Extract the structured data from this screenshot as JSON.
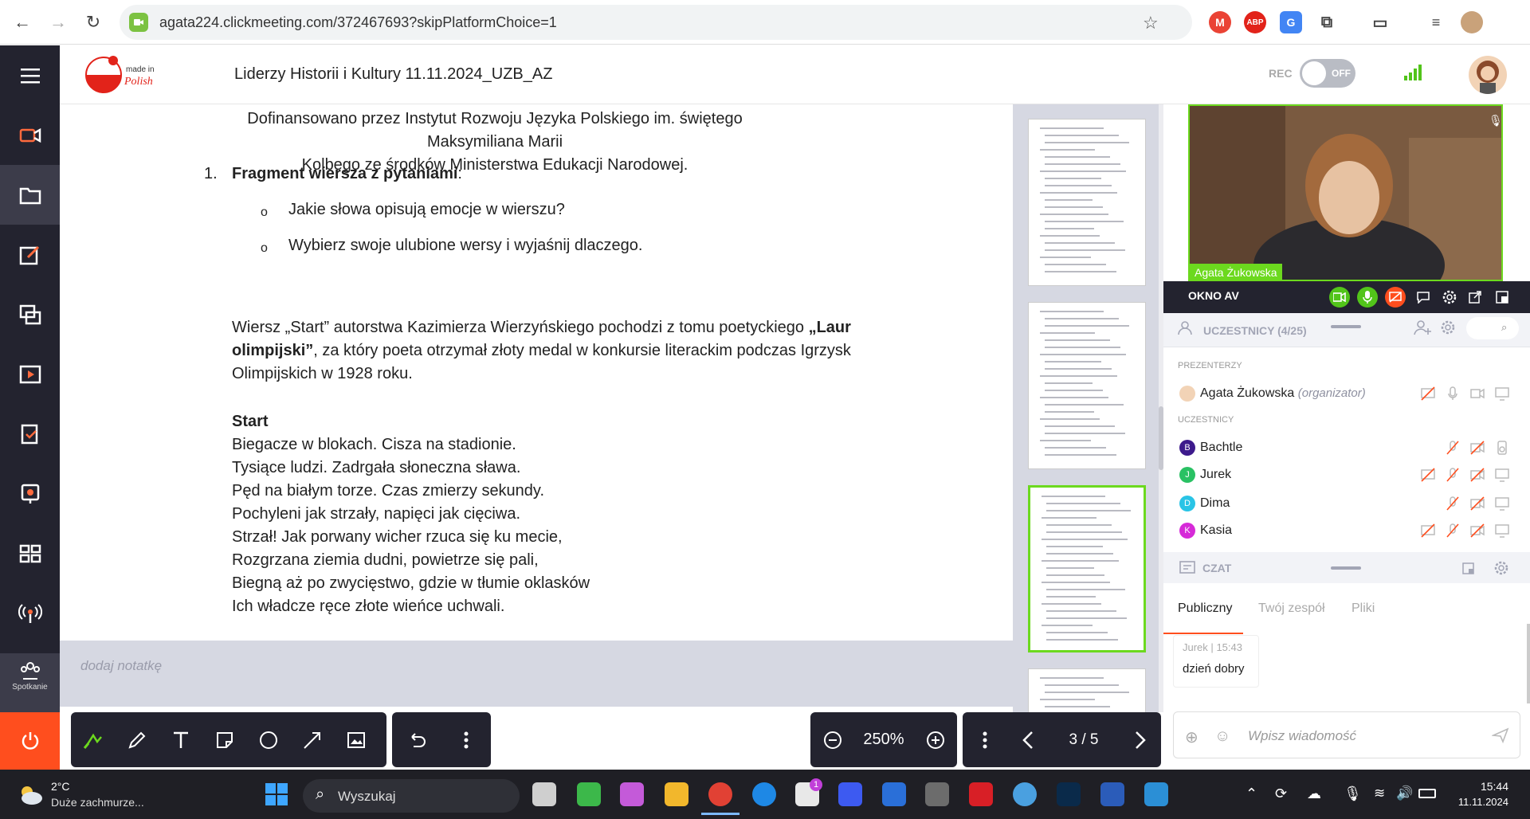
{
  "browser": {
    "url": "agata224.clickmeeting.com/372467693?skipPlatformChoice=1",
    "nav_icons": [
      "back-icon",
      "forward-icon",
      "reload-icon"
    ],
    "extensions": [
      "gmail-icon",
      "adblock-icon",
      "google-icon",
      "puzzle-icon",
      "reading-list-icon",
      "media-icon",
      "profile-icon"
    ]
  },
  "header": {
    "logo_text": "made in Polish",
    "meeting_title": "Liderzy Historii i Kultury 11.11.2024_UZB_AZ",
    "rec_label": "REC",
    "rec_state": "OFF"
  },
  "rail": {
    "items": [
      "menu-icon",
      "camera-icon",
      "folder-icon",
      "whiteboard-icon",
      "screen-share-icon",
      "video-play-icon",
      "survey-icon",
      "test-icon",
      "apps-icon",
      "broadcast-icon"
    ],
    "spotkanie_label": "Spotkanie"
  },
  "document": {
    "funding_line1": "Dofinansowano przez Instytut Rozwoju Języka Polskiego im. świętego Maksymiliana Marii",
    "funding_line2": "Kolbego ze środków Ministerstwa Edukacji Narodowej.",
    "item_number": "1.",
    "item_title": "Fragment wiersza z pytaniami",
    "item_colon": ":",
    "bullet_marker": "o",
    "bullets": [
      "Jakie słowa opisują emocje w wierszu?",
      "Wybierz swoje ulubione wersy i wyjaśnij dlaczego."
    ],
    "intro_a": "Wiersz „Start” autorstwa Kazimierza Wierzyńskiego pochodzi z tomu poetyckiego ",
    "intro_bold1": "„Laur",
    "intro_bold2": "olimpijski”",
    "intro_b": ", za który poeta otrzymał złoty medal w konkursie literackim podczas Igrzysk",
    "intro_c": "Olimpijskich w 1928 roku.",
    "poem_title": "Start",
    "poem_lines": [
      "Biegacze w blokach. Cisza na stadionie.",
      "Tysiące ludzi. Zadrgała słoneczna sława.",
      "Pęd na białym torze. Czas zmierzy sekundy.",
      "Pochyleni jak strzały, napięci jak cięciwa.",
      "Strzał! Jak porwany wicher rzuca się ku mecie,",
      "Rozgrzana ziemia dudni, powietrze się pali,",
      "Biegną aż po zwycięstwo, gdzie w tłumie oklasków",
      "Ich władcze ręce złote wieńce uchwali."
    ],
    "note_placeholder": "dodaj notatkę"
  },
  "toolbar": {
    "zoom": "250%",
    "page": "3 / 5"
  },
  "video": {
    "name": "Agata Żukowska",
    "av_label": "OKNO AV"
  },
  "participants": {
    "title": "UCZESTNICY (4/25)",
    "presenters_label": "PREZENTERZY",
    "attendees_label": "UCZESTNICY",
    "presenter": {
      "name": "Agata Żukowska",
      "role": "(organizator)"
    },
    "list": [
      {
        "initial": "B",
        "name": "Bachtle",
        "color": "#3d1a8c"
      },
      {
        "initial": "J",
        "name": "Jurek",
        "color": "#29c163"
      },
      {
        "initial": "D",
        "name": "Dima",
        "color": "#29c4e6"
      },
      {
        "initial": "K",
        "name": "Kasia",
        "color": "#d62ad8"
      }
    ]
  },
  "chat": {
    "title": "CZAT",
    "tabs": [
      "Publiczny",
      "Twój zespół",
      "Pliki"
    ],
    "message_author": "Jurek",
    "message_sep": "|",
    "message_time": "15:43",
    "message_text": "dzień dobry",
    "input_placeholder": "Wpisz wiadomość"
  },
  "taskbar": {
    "temp": "2°C",
    "weather": "Duże zachmurze...",
    "search": "Wyszukaj",
    "time": "15:44",
    "date": "11.11.2024",
    "store_badge": "1"
  }
}
